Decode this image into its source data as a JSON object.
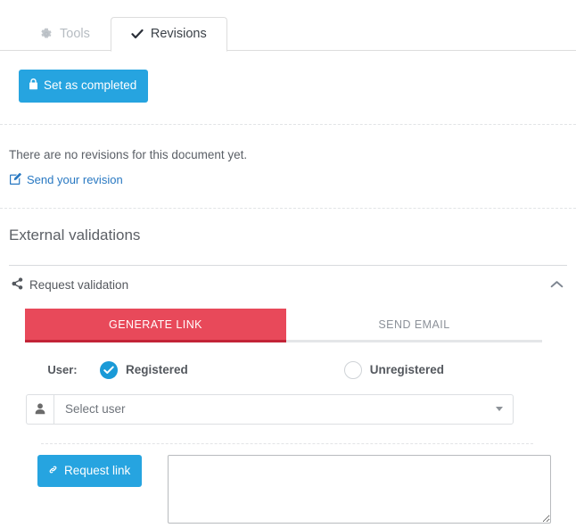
{
  "tabs": [
    {
      "label": "Tools",
      "icon": "gear-icon",
      "active": false
    },
    {
      "label": "Revisions",
      "icon": "check-icon",
      "active": true
    }
  ],
  "toolbar": {
    "set_completed_label": "Set as completed",
    "set_completed_icon": "lock-icon"
  },
  "revisions": {
    "empty_message": "There are no revisions for this document yet.",
    "send_revision_label": "Send your revision",
    "send_revision_icon": "edit-pencil-square-icon"
  },
  "external_validations": {
    "title": "External validations",
    "panel": {
      "header_label": "Request validation",
      "header_icon": "share-alt-icon",
      "collapse_icon": "chevron-up-icon",
      "expanded": true
    },
    "inner_tabs": [
      {
        "label": "GENERATE LINK",
        "active": true
      },
      {
        "label": "SEND EMAIL",
        "active": false
      }
    ],
    "form": {
      "user_label": "User:",
      "radios": [
        {
          "label": "Registered",
          "selected": true,
          "icon": "check-icon"
        },
        {
          "label": "Unregistered",
          "selected": false
        }
      ],
      "select_user": {
        "addon_icon": "user-icon",
        "placeholder": "Select user",
        "value": "",
        "caret_icon": "caret-down-icon"
      },
      "request_link_label": "Request link",
      "request_link_icon": "chain-link-icon",
      "result_textarea": {
        "value": "",
        "placeholder": ""
      }
    }
  },
  "colors": {
    "primary_blue": "#26a4e0",
    "tab_active_red": "#e8495a",
    "tab_active_red_border": "#c32437",
    "link_blue": "#2878c2",
    "radio_blue": "#1a9ad7",
    "border_gray": "#dddddd",
    "text_gray": "#54585e",
    "muted_gray": "#b6bcc2"
  }
}
